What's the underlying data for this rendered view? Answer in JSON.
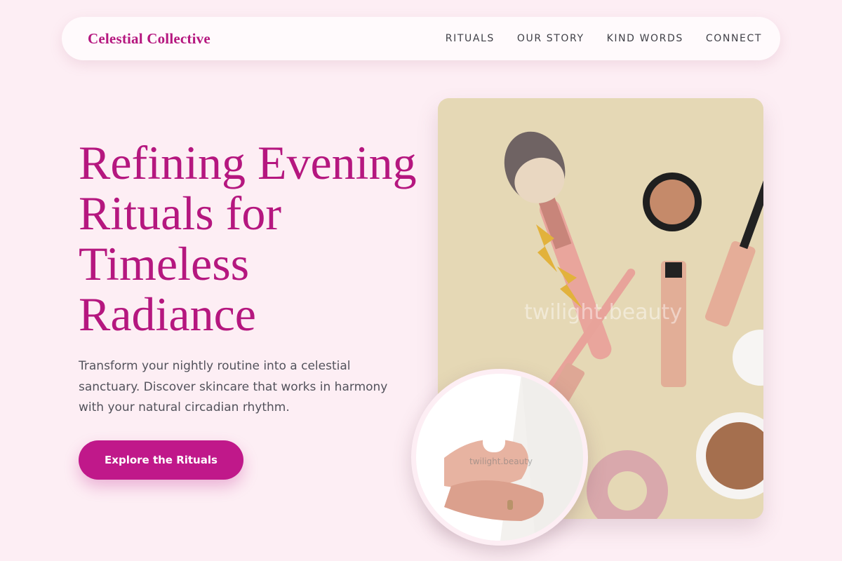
{
  "brand": {
    "name": "Celestial Collective"
  },
  "nav": {
    "items": [
      "RITUALS",
      "OUR STORY",
      "KIND WORDS",
      "CONNECT"
    ]
  },
  "hero": {
    "title": "Refining Evening Rituals for Timeless Radiance",
    "lead": "Transform your nightly routine into a celestial sanctuary. Discover skincare that works in harmony with your natural circadian rhythm.",
    "cta": "Explore the Rituals"
  },
  "media": {
    "main_watermark": "twilight.beauty",
    "circle_watermark": "twilight.beauty"
  },
  "colors": {
    "accent": "#b5177f",
    "button": "#c0188a",
    "background": "#fdeef4"
  }
}
